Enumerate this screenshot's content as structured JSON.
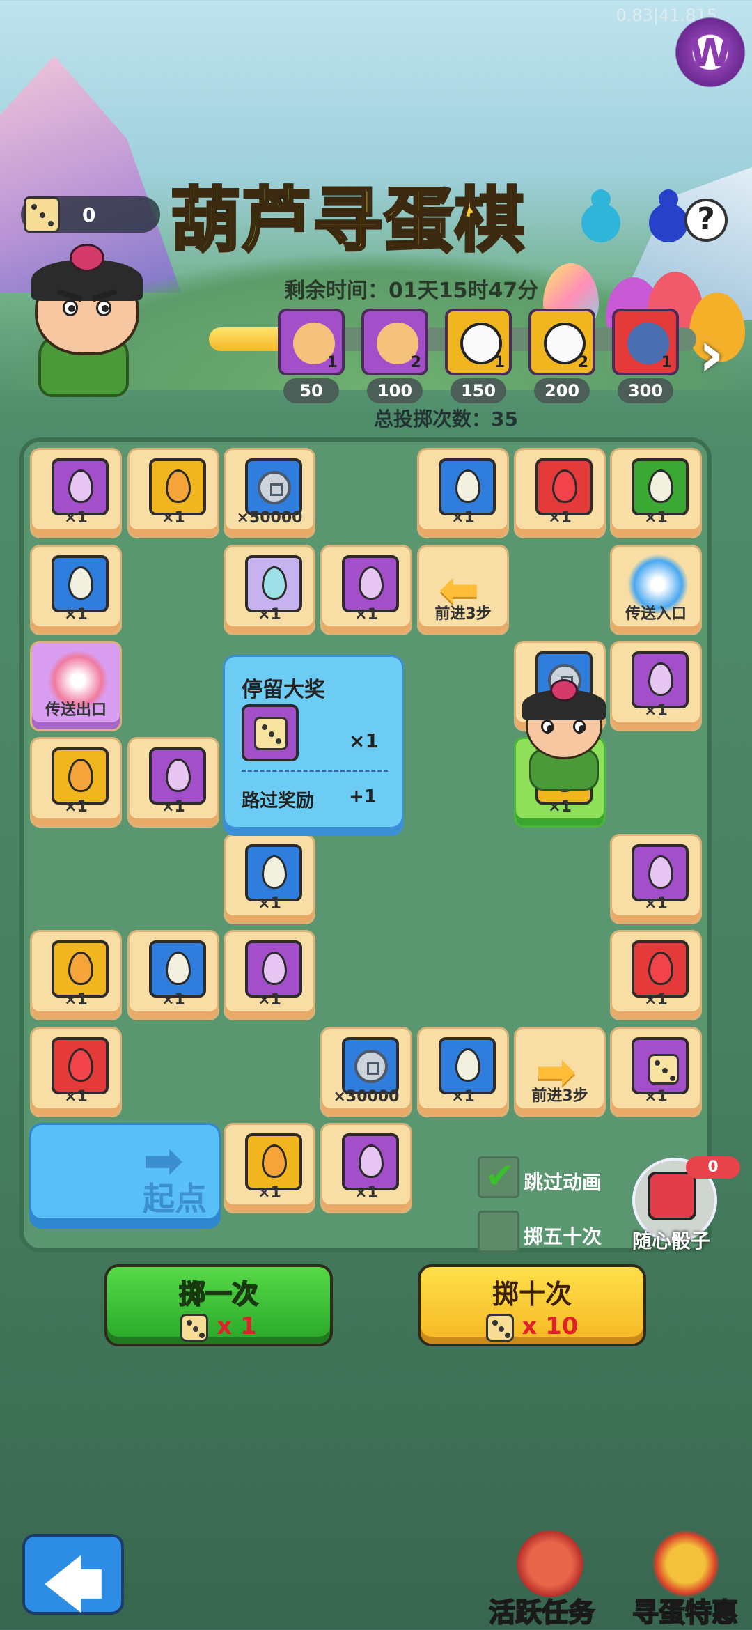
{
  "status": {
    "timer_text": "0.83|41.815"
  },
  "header": {
    "title_part1": "葫芦",
    "title_part2": "寻蛋棋",
    "dice_count": "0",
    "help": "?",
    "countdown": "剩余时间：01天15时47分",
    "total_rolls": "总投掷次数：35"
  },
  "progress": {
    "fill_fraction": 0.17,
    "rewards": [
      {
        "count": "1",
        "threshold": "50",
        "color": "#a34fc9"
      },
      {
        "count": "2",
        "threshold": "100",
        "color": "#a34fc9"
      },
      {
        "count": "1",
        "threshold": "150",
        "color": "#f1b51e"
      },
      {
        "count": "2",
        "threshold": "200",
        "color": "#f1b51e"
      },
      {
        "count": "1",
        "threshold": "300",
        "color": "#e53a3a"
      }
    ]
  },
  "board": {
    "tiles": [
      {
        "label": "×1",
        "color": "#a34fc9",
        "egg": "#e8c6f4"
      },
      {
        "label": "×1",
        "color": "#f1b51e",
        "egg": "#f5a43a"
      },
      {
        "label": "×50000",
        "color": "#2f7ddc",
        "coin": true
      },
      {
        "label": "×1",
        "color": "#2f7ddc",
        "egg": "#f2f0df"
      },
      {
        "label": "×1",
        "color": "#e53a3a",
        "egg": "#f2424a"
      },
      {
        "label": "×1",
        "color": "#3aa832",
        "egg": "#f2f0df"
      },
      {
        "label": "×1",
        "color": "#2f7ddc",
        "egg": "#f2f0df"
      },
      {
        "label": "×1",
        "color": "#c7b2f0",
        "egg": "#9ee0e8"
      },
      {
        "label": "×1",
        "color": "#a34fc9",
        "egg": "#e8c6f4"
      },
      {
        "label": "前进3步",
        "arrow": "left"
      },
      {
        "label": "传送入口",
        "swirl": "#4aa8f0"
      },
      {
        "label": "传送出口",
        "swirl": "#f07aa0"
      },
      {
        "label": "×1",
        "color": "#a34fc9",
        "egg": "#e8c6f4"
      },
      {
        "label": "×1",
        "color": "#f1b51e",
        "egg": "#f5a43a"
      },
      {
        "label": "×1",
        "color": "#a34fc9",
        "egg": "#e8c6f4"
      },
      {
        "label": "×1",
        "color": "#2f7ddc",
        "coin": true
      },
      {
        "label": "×1",
        "color": "#f1b51e",
        "egg": "#f5a43a"
      },
      {
        "label": "×1",
        "color": "#2f7ddc",
        "egg": "#f2f0df"
      },
      {
        "label": "×1",
        "color": "#a34fc9",
        "egg": "#e8c6f4"
      },
      {
        "label": "×1",
        "color": "#f1b51e",
        "egg": "#f5a43a"
      },
      {
        "label": "×1",
        "color": "#2f7ddc",
        "egg": "#f2f0df"
      },
      {
        "label": "×1",
        "color": "#a34fc9",
        "egg": "#e8c6f4"
      },
      {
        "label": "×1",
        "color": "#e53a3a",
        "egg": "#f2424a"
      },
      {
        "label": "×1",
        "color": "#e53a3a",
        "egg": "#f2424a"
      },
      {
        "label": "×30000",
        "color": "#2f7ddc",
        "coin": true
      },
      {
        "label": "×1",
        "color": "#2f7ddc",
        "egg": "#f2f0df"
      },
      {
        "label": "前进3步",
        "arrow": "right"
      },
      {
        "label": "×1",
        "color": "#a34fc9",
        "dice": true
      },
      {
        "label": "×1",
        "color": "#f1b51e",
        "egg": "#f5a43a"
      },
      {
        "label": "×1",
        "color": "#a34fc9",
        "egg": "#e8c6f4"
      }
    ],
    "grand_prize": {
      "title": "停留大奖",
      "multiplier": "×1",
      "pass_reward": "路过奖励",
      "pass_value": "+1"
    },
    "start_label": "起点",
    "start_arrow": "➡"
  },
  "options": {
    "skip_animation": "跳过动画",
    "roll_fifty": "掷五十次",
    "random_dice": "随心骰子",
    "random_dice_count": "0"
  },
  "actions": {
    "roll_once": "掷一次",
    "roll_once_cost": "x 1",
    "roll_ten": "掷十次",
    "roll_ten_cost": "x 10"
  },
  "bottom": {
    "back_arrow": "🡄",
    "active_tasks": "活跃任务",
    "egg_deals": "寻蛋特惠"
  }
}
